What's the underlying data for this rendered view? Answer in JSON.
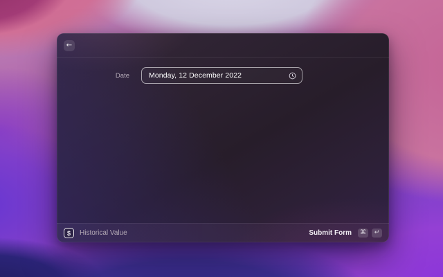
{
  "window": {
    "header": {
      "back_icon": "←"
    },
    "form": {
      "fields": [
        {
          "label": "Date",
          "value": "Monday, 12 December 2022",
          "trailing_icon": "clock-icon"
        }
      ]
    },
    "footer": {
      "extension_icon_glyph": "$",
      "extension_name": "Historical Value",
      "primary_action": {
        "label": "Submit Form",
        "shortcut": [
          "⌘",
          "↵"
        ]
      }
    }
  },
  "colors": {
    "window_base": "#2a1f2e",
    "field_border": "rgba(255,255,255,0.58)",
    "text_primary": "#ffffff",
    "text_secondary": "#b4aab6",
    "kbd_background": "rgba(255,255,255,0.15)",
    "wallpaper_palette": [
      "#a23b76",
      "#d0688f",
      "#dad7e8",
      "#c9729f",
      "#8b3fc4",
      "#6636d2",
      "#3d2f92",
      "#8c35d9",
      "#221d60"
    ]
  }
}
